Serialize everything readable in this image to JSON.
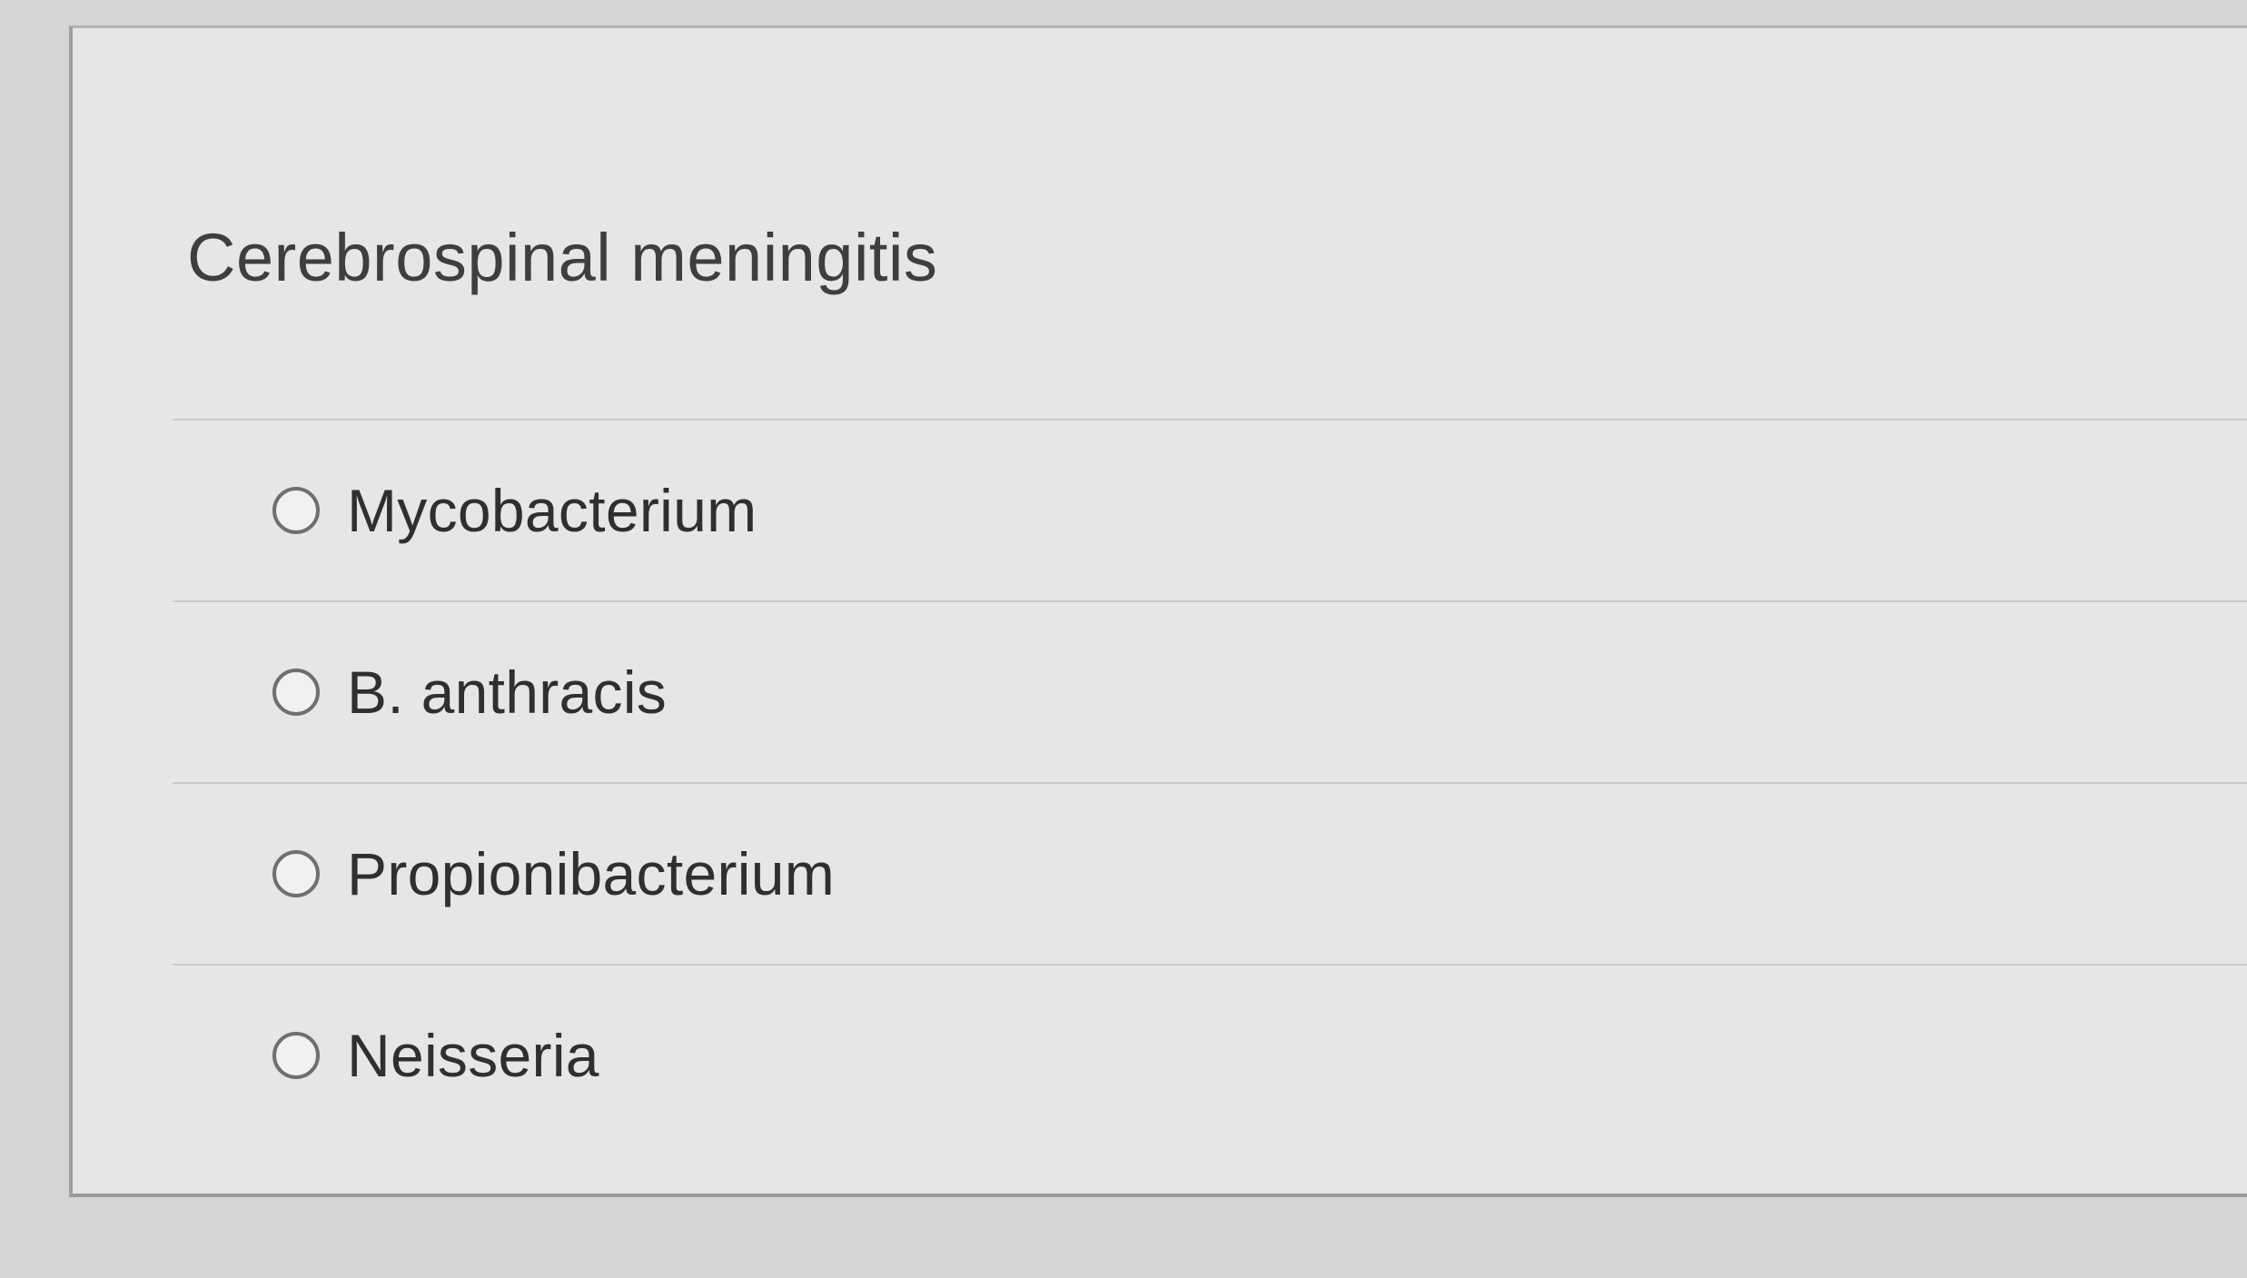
{
  "question": {
    "title": "Cerebrospinal meningitis"
  },
  "options": [
    {
      "label": "Mycobacterium",
      "selected": false
    },
    {
      "label": "B. anthracis",
      "selected": false
    },
    {
      "label": "Propionibacterium",
      "selected": false
    },
    {
      "label": "Neisseria",
      "selected": false
    }
  ]
}
